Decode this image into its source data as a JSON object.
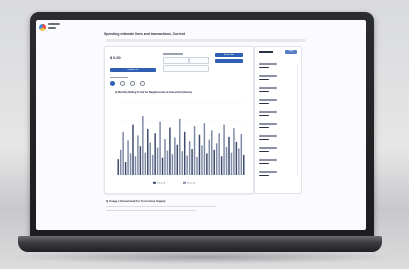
{
  "screen": {
    "page_title": "Spending estimate lines and transactions, Current",
    "balance_value": "$ 0.00",
    "search_label": "Q Monthly Billing Trend for Neighbourhood Household (Sumo)",
    "section_heading": "Q Usage | Occasional/ for Your Home Supply",
    "panel_button": "Apply",
    "actions": [
      "Update now",
      "Export data"
    ]
  },
  "colors": {
    "accent": "#2f5fb3",
    "bars": "#7f8aa6",
    "bars_dark": "#3d4a6b"
  },
  "chart_data": {
    "type": "bar",
    "title": "Q Monthly Billing Trend for Neighbourhood Household (Sumo)",
    "xlabel": "",
    "ylabel": "",
    "ylim": [
      0,
      100
    ],
    "grid": true,
    "values": [
      22,
      35,
      60,
      18,
      48,
      30,
      70,
      26,
      55,
      40,
      82,
      31,
      64,
      45,
      28,
      58,
      38,
      74,
      24,
      50,
      34,
      66,
      29,
      52,
      42,
      78,
      33,
      60,
      27,
      47,
      36,
      68,
      25,
      56,
      41,
      72,
      30,
      49,
      62,
      35,
      44,
      58,
      26,
      70,
      39,
      53,
      31,
      65,
      46,
      37,
      57,
      28
    ],
    "legend": [
      "Series A",
      "Series B"
    ]
  }
}
